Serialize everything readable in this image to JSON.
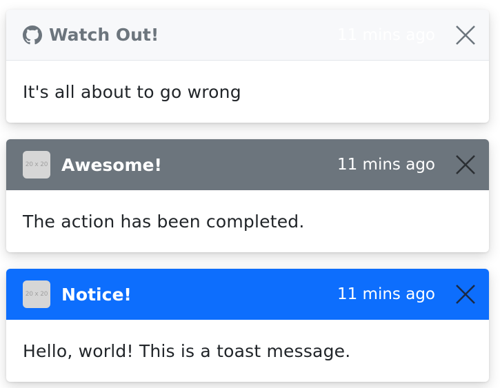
{
  "toasts": [
    {
      "title": "Watch Out!",
      "time": "11 mins ago",
      "message": "It's all about to go wrong",
      "icon": "github-icon",
      "header_color": "#f7f8fa"
    },
    {
      "title": "Awesome!",
      "time": "11 mins ago",
      "message": "The action has been completed.",
      "icon": "placeholder-image",
      "thumb_label": "20 x 20",
      "header_color": "#6c757d"
    },
    {
      "title": "Notice!",
      "time": "11 mins ago",
      "message": "Hello, world! This is a toast message.",
      "icon": "placeholder-image",
      "thumb_label": "20 x 20",
      "header_color": "#0d6efd"
    }
  ]
}
